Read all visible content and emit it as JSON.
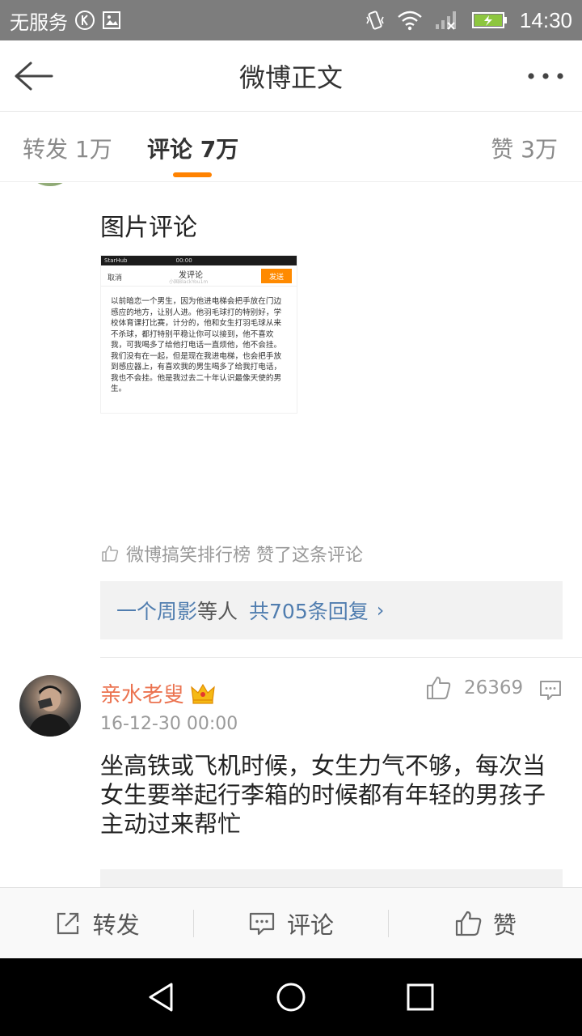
{
  "status_bar": {
    "carrier": "无服务",
    "time": "14:30"
  },
  "header": {
    "title": "微博正文"
  },
  "tabs": {
    "repost": "转发 1万",
    "comment": "评论 7万",
    "like": "赞 3万"
  },
  "comment1": {
    "text": "图片评论",
    "image": {
      "status": "StarHub",
      "time": "00:00",
      "cancel": "取消",
      "title": "发评论",
      "subtitle": "小国BlackYou1m",
      "send": "发送",
      "body": "以前暗恋一个男生，因为他进电梯会把手放在门边感应的地方，让别人进。他羽毛球打的特别好，学校体育课打比赛，计分的，他和女生打羽毛球从来不杀球，都打特别平稳让你可以接到，他不喜欢我，可我喝多了给他打电话一直烦他，他不会挂。我们没有在一起，但是现在我进电梯，也会把手放到感应器上，有喜欢我的男生喝多了给我打电话，我也不会挂。他是我过去二十年认识最像天使的男生。"
    },
    "liked_by": "微博搞笑排行榜 赞了这条评论",
    "replies": {
      "user": "一个周影",
      "etc": "等人",
      "count": "共705条回复",
      "arrow": "›"
    }
  },
  "comment2": {
    "username": "亲水老叟",
    "date": "16-12-30 00:00",
    "likes": "26369",
    "text": "坐高铁或飞机时候，女生力气不够，每次当女生要举起行李箱的时候都有年轻的男孩子主动过来帮忙"
  },
  "actions": {
    "repost": "转发",
    "comment": "评论",
    "like": "赞"
  },
  "colors": {
    "accent": "#ff8200",
    "link": "#507daf",
    "username": "#eb7350"
  },
  "icons": [
    "k-icon",
    "image-icon",
    "vibrate-icon",
    "wifi-icon",
    "signal-icon",
    "battery-icon",
    "back-arrow-icon",
    "more-icon",
    "thumb-up-icon",
    "crown-icon",
    "comment-icon",
    "share-icon",
    "nav-back-icon",
    "nav-home-icon",
    "nav-recent-icon"
  ]
}
